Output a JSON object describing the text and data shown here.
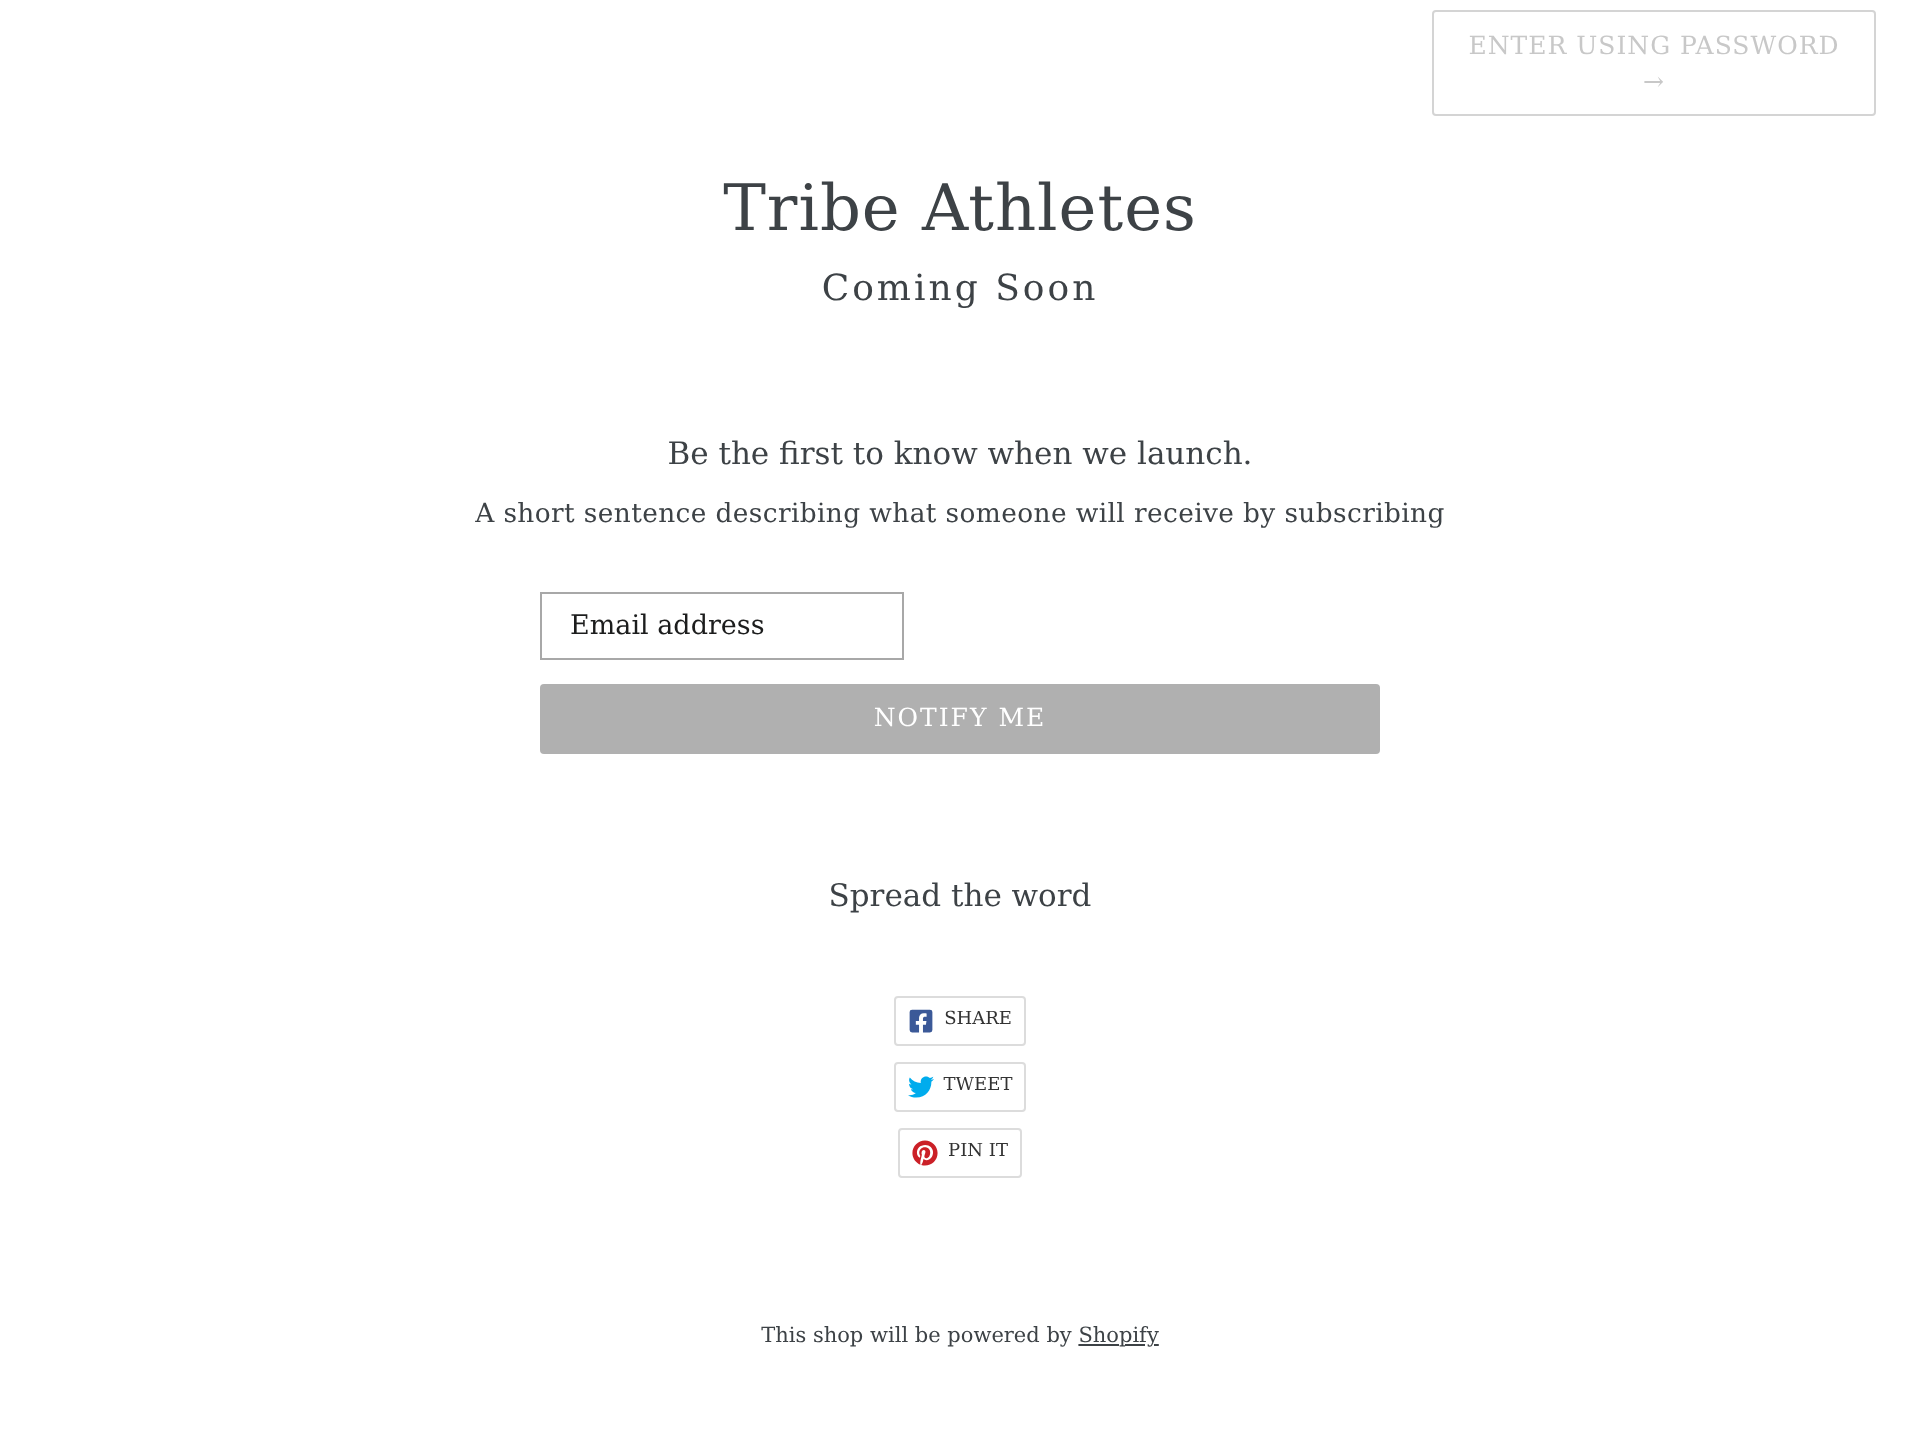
{
  "password_button": {
    "label": "ENTER USING PASSWORD",
    "arrow": "→"
  },
  "header": {
    "title": "Tribe Athletes",
    "subtitle": "Coming Soon"
  },
  "newsletter": {
    "heading": "Be the first to know when we launch.",
    "description": "A short sentence describing what someone will receive by subscribing",
    "email_field": {
      "placeholder": "Email address"
    },
    "submit_button": "NOTIFY ME"
  },
  "share": {
    "heading": "Spread the word",
    "buttons": [
      {
        "kind": "facebook",
        "label": "SHARE"
      },
      {
        "kind": "twitter",
        "label": "TWEET"
      },
      {
        "kind": "pinterest",
        "label": "PIN IT"
      }
    ]
  },
  "footer": {
    "text": "This shop will be powered by",
    "link": "Shopify"
  }
}
